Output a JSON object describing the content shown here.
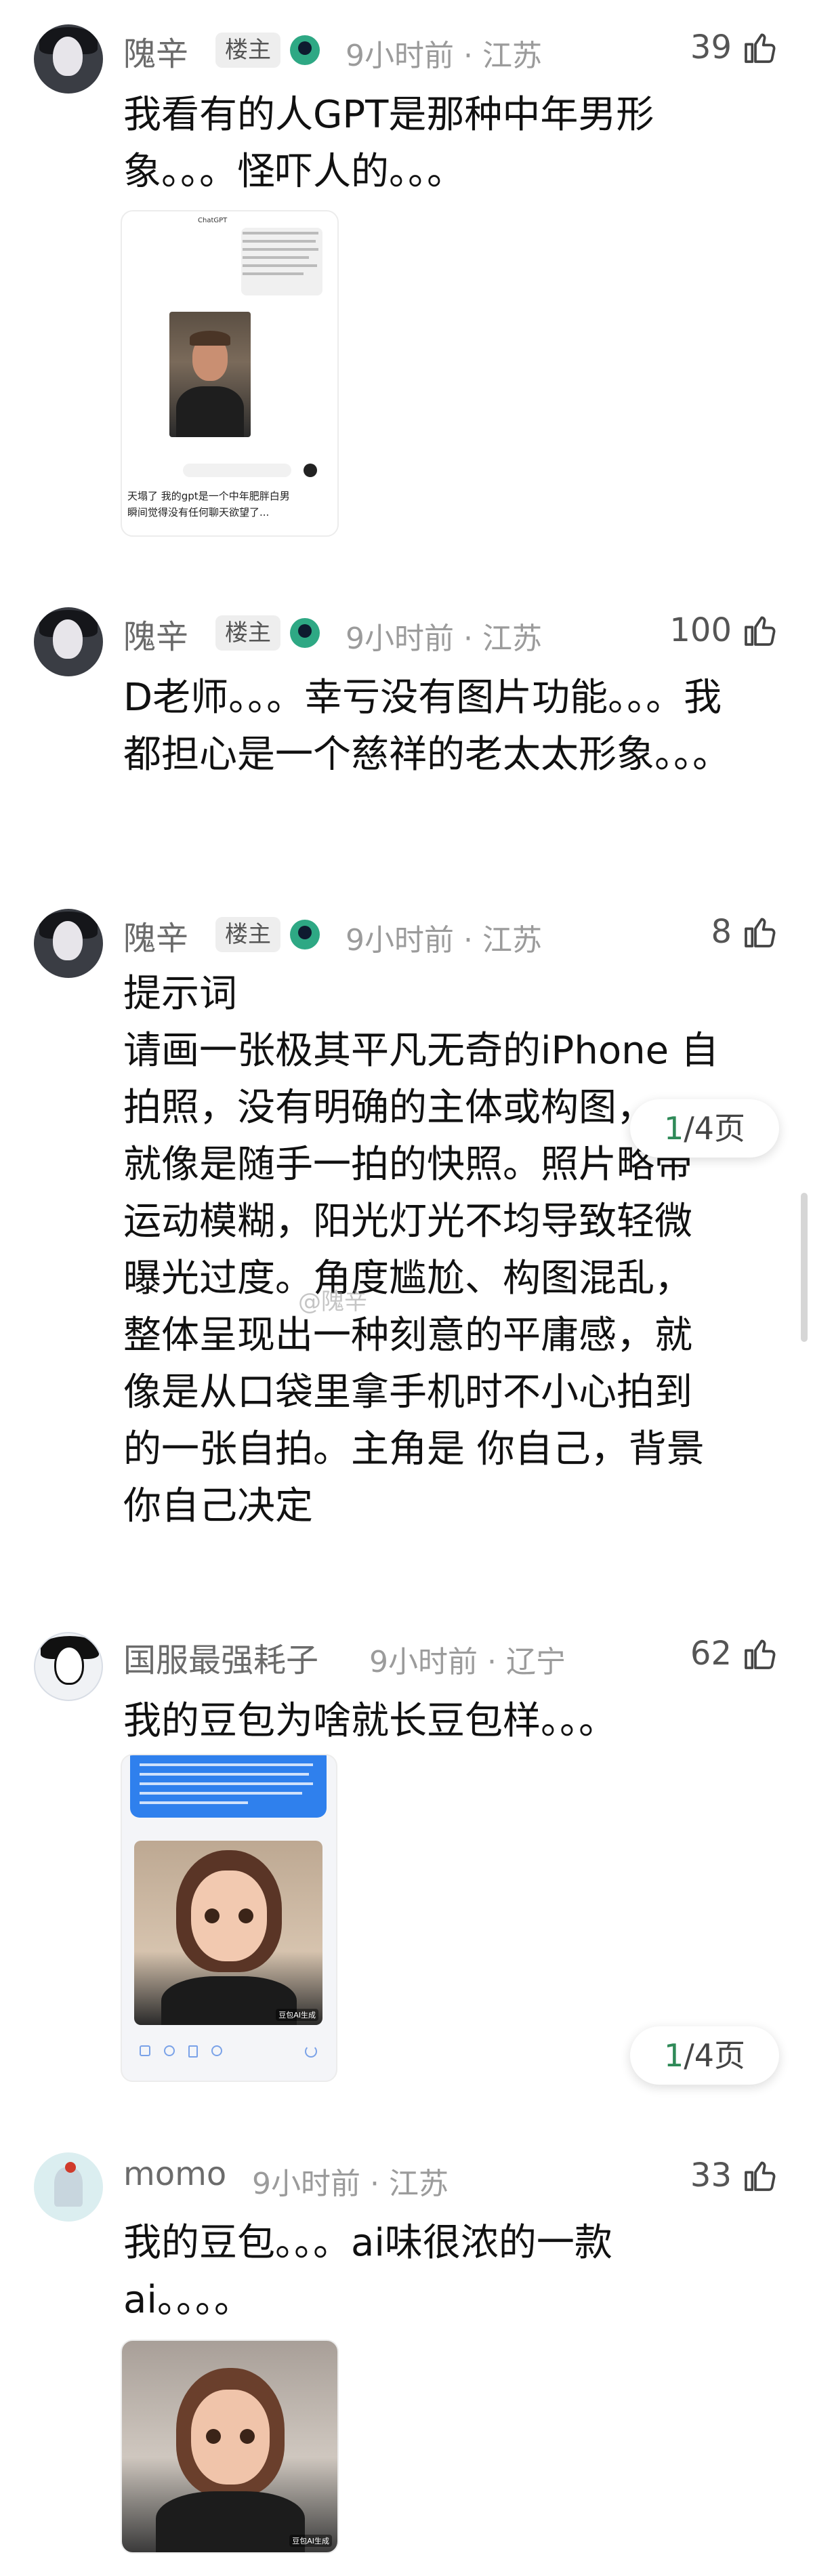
{
  "comments": [
    {
      "name": "隗辛",
      "badge": "楼主",
      "meta": "9小时前 · 江苏",
      "likes": "39",
      "text": "我看有的人GPT是那种中年男形象。。。怪吓人的。。。",
      "attachment": {
        "header": "ChatGPT",
        "caption": "天塌了 我的gpt是一个中年肥胖白男\n瞬间觉得没有任何聊天欲望了..."
      }
    },
    {
      "name": "隗辛",
      "badge": "楼主",
      "meta": "9小时前 · 江苏",
      "likes": "100",
      "text": "D老师。。。幸亏没有图片功能。。。我都担心是一个慈祥的老太太形象。。。"
    },
    {
      "name": "隗辛",
      "badge": "楼主",
      "meta": "9小时前 · 江苏",
      "likes": "8",
      "lines": [
        "提示词",
        "请画一张极其平凡无奇的iPhone 自",
        "拍照，没有明确的主体或构图，",
        "就像是随手一拍的快照。照片略带",
        "运动模糊，阳光灯光不均导致轻微",
        "曝光过度。角度尴尬、构图混乱，",
        "整体呈现出一种刻意的平庸感，就",
        "像是从口袋里拿手机时不小心拍到",
        "的一张自拍。主角是 你自己，背景",
        "你自己决定"
      ],
      "pager": {
        "current": "1",
        "total": "/4页"
      },
      "watermark": "@隗辛"
    },
    {
      "name": "国服最强耗子",
      "meta": "9小时前 · 辽宁",
      "likes": "62",
      "text": "我的豆包为啥就长豆包样。。。",
      "attachment": {
        "tag": "豆包AI生成"
      },
      "pager": {
        "current": "1",
        "total": "/4页"
      }
    },
    {
      "name": "momo",
      "meta": "9小时前 · 江苏",
      "likes": "33",
      "text": "我的豆包。。。ai味很浓的一款ai。。。。",
      "attachment": {
        "tag": "豆包AI生成"
      }
    }
  ],
  "colors": {
    "medal": "#2ea884",
    "pager_current": "#2f8a58",
    "bubble": "#2f80ed"
  }
}
